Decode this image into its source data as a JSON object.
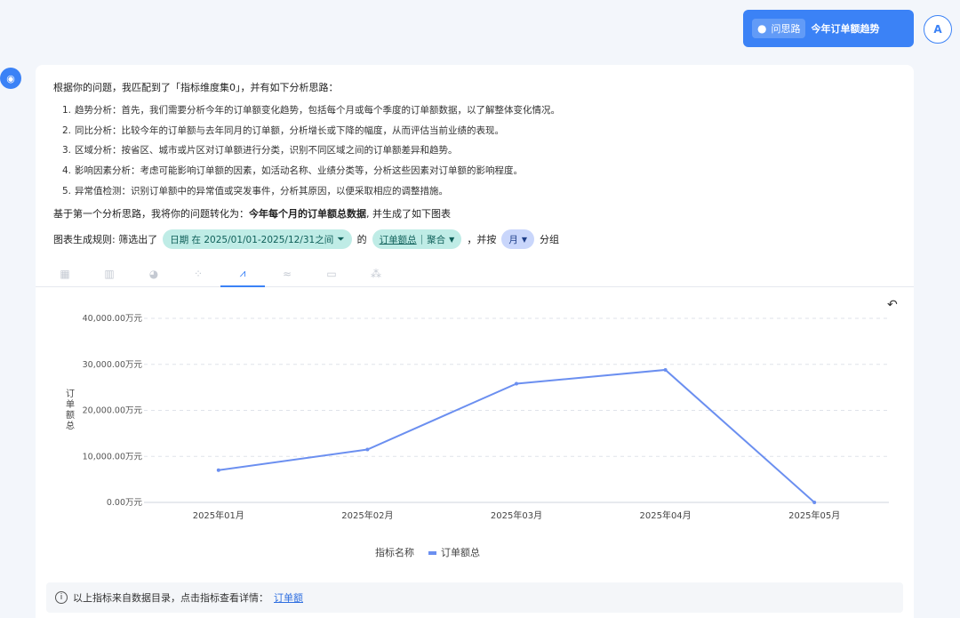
{
  "query": {
    "chip_label": "问思路",
    "text": "今年订单额趋势"
  },
  "user_avatar": "A",
  "answer": {
    "intro": "根据你的问题，我匹配到了「指标维度集0」，并有如下分析思路：",
    "steps": [
      {
        "num": "1.",
        "text": "趋势分析：首先，我们需要分析今年的订单额变化趋势，包括每个月或每个季度的订单额数据，以了解整体变化情况。"
      },
      {
        "num": "2.",
        "text": "同比分析：比较今年的订单额与去年同月的订单额，分析增长或下降的幅度，从而评估当前业绩的表现。"
      },
      {
        "num": "3.",
        "text": "区域分析：按省区、城市或片区对订单额进行分类，识别不同区域之间的订单额差异和趋势。"
      },
      {
        "num": "4.",
        "text": "影响因素分析：考虑可能影响订单额的因素，如活动名称、业绩分类等，分析这些因素对订单额的影响程度。"
      },
      {
        "num": "5.",
        "text": "异常值检测：识别订单额中的异常值或突发事件，分析其原因，以便采取相应的调整措施。"
      }
    ],
    "convert_prefix": "基于第一个分析思路，我将你的问题转化为：",
    "convert_bold": "今年每个月的订单额总数据",
    "convert_suffix": ", 并生成了如下图表",
    "rule_prefix": "图表生成规则: 筛选出了",
    "filter_pill": "日期 在 2025/01/01-2025/12/31之间",
    "rule_of": "的",
    "measure_name": "订单额总",
    "measure_agg": "聚合",
    "rule_by": "，并按",
    "group_pill": "月",
    "rule_group": "分组"
  },
  "chart_tabs": [
    {
      "icon": "table-icon",
      "glyph": "▦"
    },
    {
      "icon": "bar-chart-icon",
      "glyph": "▥"
    },
    {
      "icon": "pie-chart-icon",
      "glyph": "◕"
    },
    {
      "icon": "scatter-icon",
      "glyph": "⁘"
    },
    {
      "icon": "line-chart-icon",
      "glyph": "⩘"
    },
    {
      "icon": "area-chart-icon",
      "glyph": "≈"
    },
    {
      "icon": "card-icon",
      "glyph": "▭"
    },
    {
      "icon": "combo-icon",
      "glyph": "⁂"
    }
  ],
  "chart_data": {
    "type": "line",
    "categories": [
      "2025年01月",
      "2025年02月",
      "2025年03月",
      "2025年04月",
      "2025年05月"
    ],
    "series": [
      {
        "name": "订单额总",
        "values": [
          7000000,
          11500000,
          25800000,
          28800000,
          0
        ]
      }
    ],
    "ylabel": "订单额总",
    "yticks": [
      "0.00万元",
      "10,000.00万元",
      "20,000.00万元",
      "30,000.00万元",
      "40,000.00万元"
    ],
    "ylim": [
      0,
      40000000
    ],
    "legend_title": "指标名称",
    "color": "#6b8ff0",
    "grid": true
  },
  "source": {
    "text": "以上指标来自数据目录，点击指标查看详情：",
    "link": "订单额"
  }
}
